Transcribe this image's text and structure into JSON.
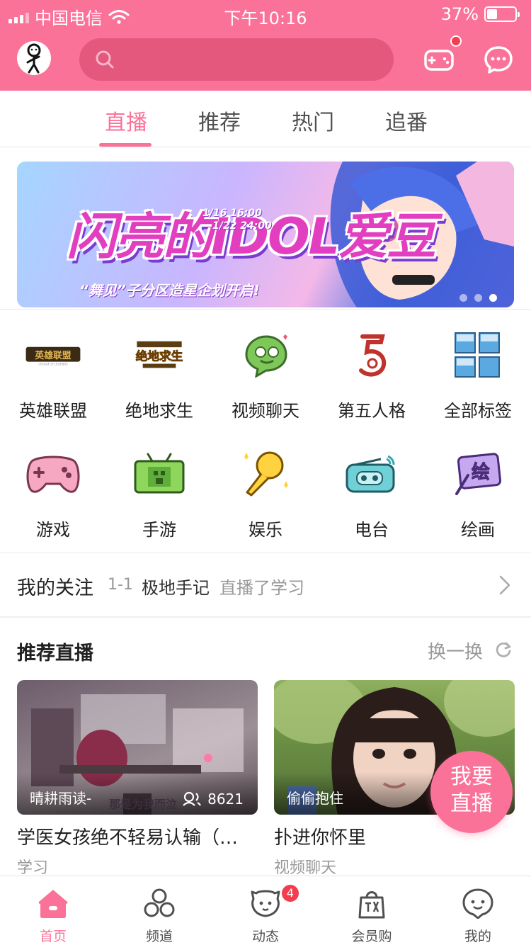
{
  "status_bar": {
    "carrier": "中国电信",
    "time": "下午10:16",
    "battery": "37%",
    "battery_level": 0.37
  },
  "header": {
    "search_placeholder": ""
  },
  "tabs": [
    {
      "label": "直播",
      "active": true
    },
    {
      "label": "推荐",
      "active": false
    },
    {
      "label": "热门",
      "active": false
    },
    {
      "label": "追番",
      "active": false
    }
  ],
  "banner": {
    "title": "闪亮的IDOL爱豆",
    "date_line1": "1/16 16:00",
    "date_line2": "—1/22 24:00",
    "subtitle": "“舞见”子分区造星企划开启!",
    "slide_count": 3,
    "active_slide": 3
  },
  "categories_row1": [
    {
      "label": "英雄联盟",
      "icon": "lol-logo-icon"
    },
    {
      "label": "绝地求生",
      "icon": "pubg-logo-icon"
    },
    {
      "label": "视频聊天",
      "icon": "video-chat-icon"
    },
    {
      "label": "第五人格",
      "icon": "identity-v-icon"
    },
    {
      "label": "全部标签",
      "icon": "all-tags-icon"
    }
  ],
  "categories_row2": [
    {
      "label": "游戏",
      "icon": "gamepad-icon"
    },
    {
      "label": "手游",
      "icon": "mobile-game-icon"
    },
    {
      "label": "娱乐",
      "icon": "microphone-icon"
    },
    {
      "label": "电台",
      "icon": "radio-icon"
    },
    {
      "label": "绘画",
      "icon": "painting-icon"
    }
  ],
  "follow": {
    "title": "我的关注",
    "date": "1-1",
    "name": "极地手记",
    "status": "直播了学习"
  },
  "recommend": {
    "title": "推荐直播",
    "refresh_label": "换一换",
    "cards": [
      {
        "owner": "晴耕雨读-",
        "views": "8621",
        "title": "学医女孩绝不轻易认输（…",
        "category": "学习",
        "overlay_text": "那是为我而泣"
      },
      {
        "owner": "偷偷抱住",
        "views": "",
        "title": "扑进你怀里",
        "category": "视频聊天"
      }
    ]
  },
  "go_live": {
    "line1": "我要",
    "line2": "直播"
  },
  "bottom_nav": [
    {
      "label": "首页",
      "icon": "home-icon",
      "active": true
    },
    {
      "label": "频道",
      "icon": "channel-icon",
      "active": false
    },
    {
      "label": "动态",
      "icon": "moments-icon",
      "active": false,
      "badge": "4"
    },
    {
      "label": "会员购",
      "icon": "shop-bag-icon",
      "active": false
    },
    {
      "label": "我的",
      "icon": "profile-icon",
      "active": false
    }
  ],
  "colors": {
    "brand_pink": "#fb7299",
    "badge_red": "#f23d4f"
  }
}
